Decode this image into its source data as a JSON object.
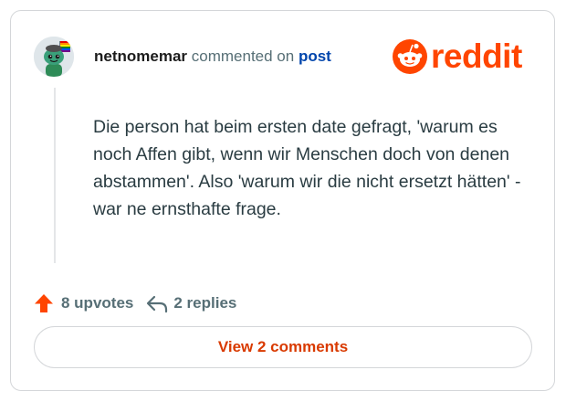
{
  "comment": {
    "username": "netnomemar",
    "action_text": "commented on",
    "post_link_text": "post",
    "body": "Die person hat beim ersten date gefragt, 'warum es noch Affen gibt, wenn wir Menschen doch von denen abstammen'. Also 'warum wir die nicht ersetzt hätten' - war ne ernsthafte frage."
  },
  "brand": {
    "logo_text": "reddit",
    "color": "#ff4500"
  },
  "stats": {
    "upvotes_label": "8 upvotes",
    "replies_label": "2 replies",
    "upvote_icon": "upvote-arrow-icon",
    "reply_icon": "reply-arrow-icon"
  },
  "actions": {
    "view_comments_label": "View 2 comments"
  },
  "colors": {
    "accent": "#ff4500",
    "link": "#0045ac",
    "button_text": "#d93a00",
    "muted": "#576f76"
  }
}
